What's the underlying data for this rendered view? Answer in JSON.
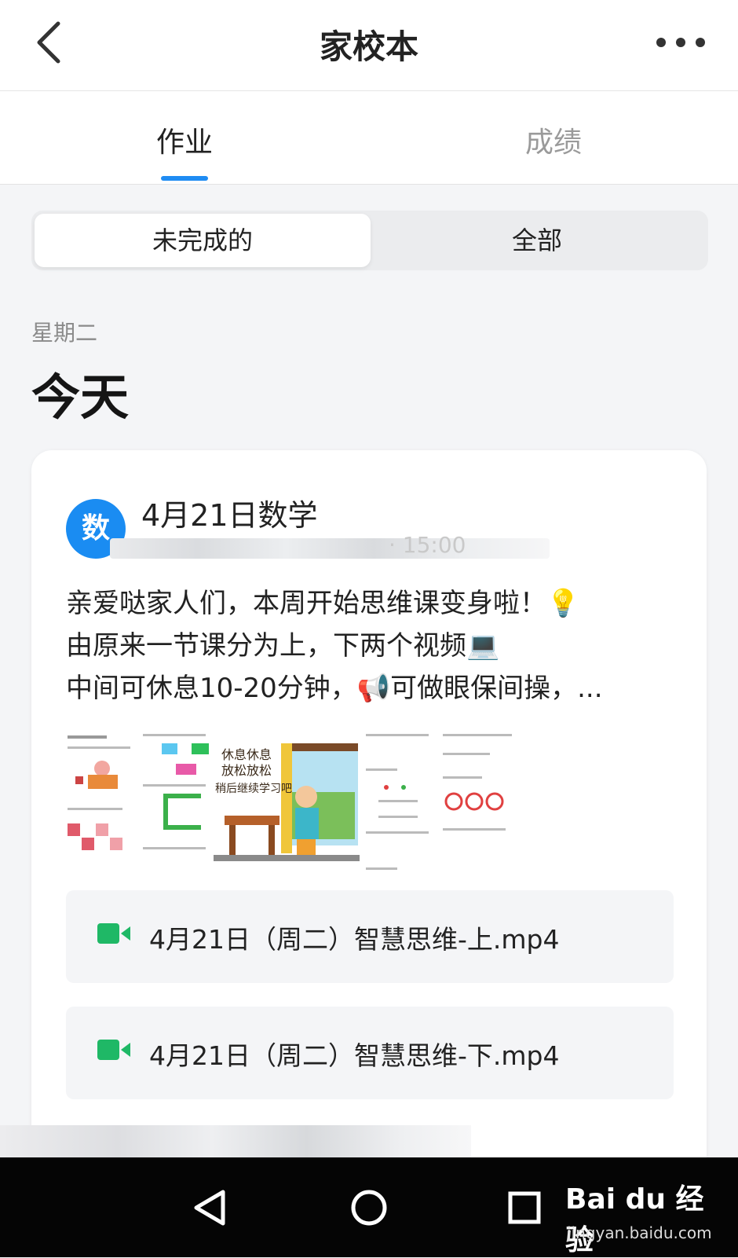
{
  "header": {
    "title": "家校本",
    "back_icon": "chevron-left-icon",
    "more_icon": "more-dots-icon"
  },
  "tabs": [
    {
      "label": "作业",
      "active": true
    },
    {
      "label": "成绩",
      "active": false
    }
  ],
  "filter": {
    "options": [
      {
        "label": "未完成的",
        "active": true
      },
      {
        "label": "全部",
        "active": false
      }
    ]
  },
  "day": {
    "weekday": "星期二",
    "label": "今天"
  },
  "homework": {
    "subject_avatar": "数",
    "title": "4月21日数学",
    "meta_time": "· 15:00",
    "description_lines": [
      "亲爱哒家人们，本周开始思维课变身啦！💡",
      "由原来一节课分为上，下两个视频💻",
      "中间可休息10-20分钟，📢可做眼保间操，..."
    ],
    "poster_text": [
      "休息休息",
      "放松放松",
      "稍后继续学习吧"
    ],
    "files": [
      {
        "name": "4月21日（周二）智慧思维-上.mp4",
        "icon": "video-camera-icon"
      },
      {
        "name": "4月21日（周二）智慧思维-下.mp4",
        "icon": "video-camera-icon"
      }
    ]
  },
  "system_nav": {
    "back_icon": "triangle-back-icon",
    "home_icon": "circle-home-icon",
    "recents_icon": "square-recents-icon"
  },
  "watermark": {
    "brand": "Bai du 经验",
    "url": "jingyan.baidu.com"
  },
  "colors": {
    "accent": "#1f8cf3",
    "video_icon": "#1fb866",
    "background": "#f4f5f7"
  }
}
